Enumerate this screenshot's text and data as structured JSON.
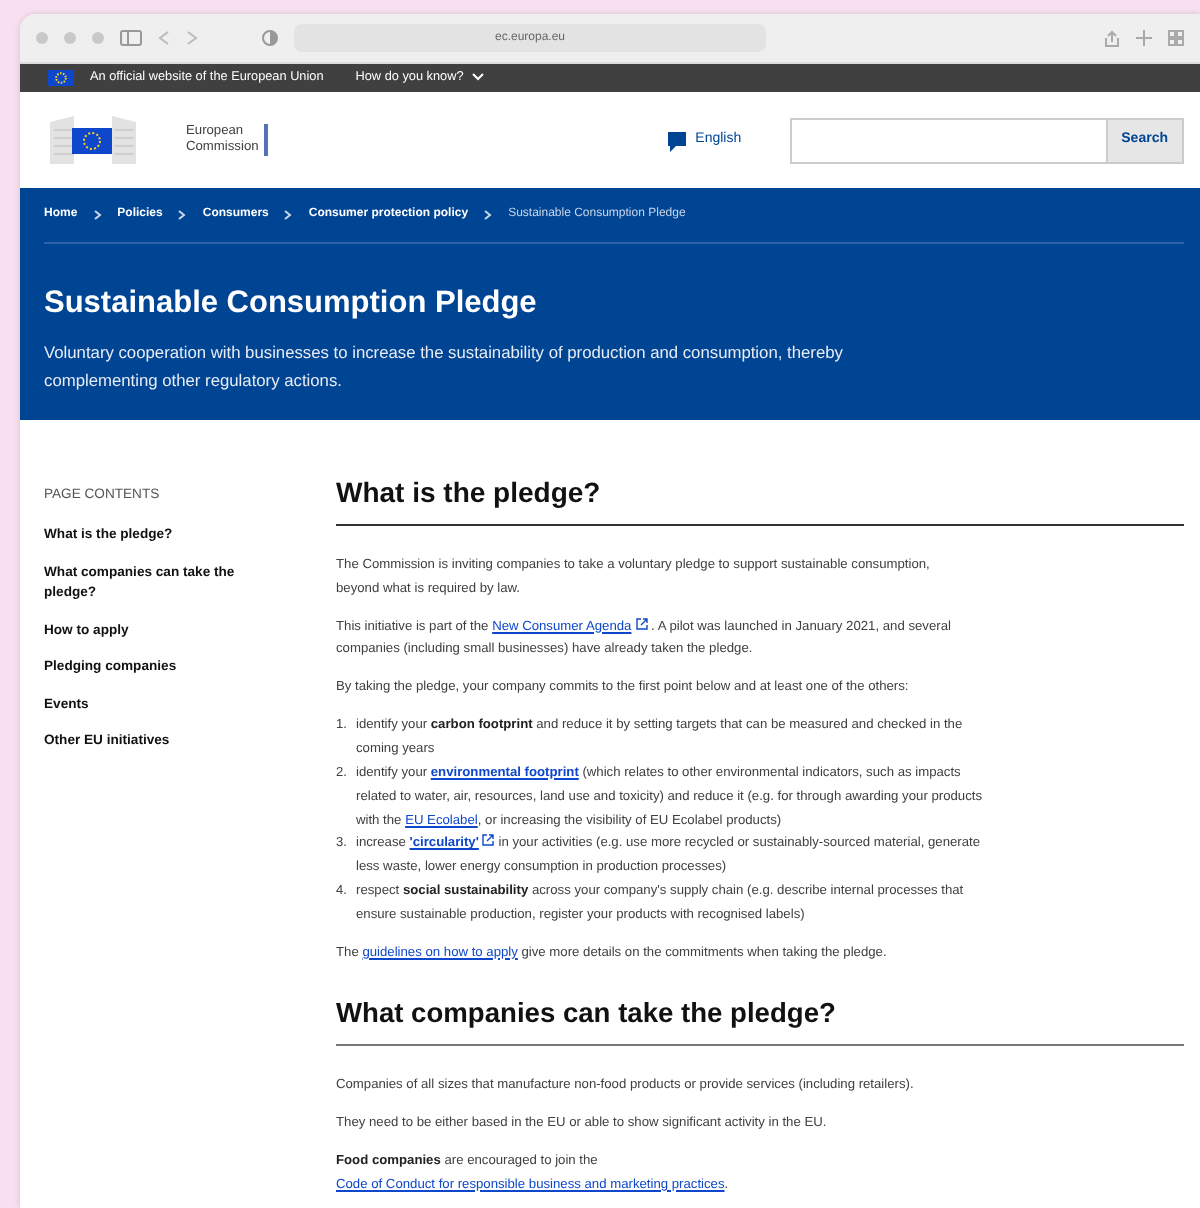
{
  "browser": {
    "url": "ec.europa.eu"
  },
  "eu_bar": {
    "text": "An official website of the European Union",
    "link": "How do you know?"
  },
  "header": {
    "logo_lines": [
      "European",
      "Commission"
    ],
    "language": "English",
    "search_button": "Search"
  },
  "breadcrumb": [
    {
      "label": "Home",
      "current": false
    },
    {
      "label": "Policies",
      "current": false
    },
    {
      "label": "Consumers",
      "current": false
    },
    {
      "label": "Consumer protection policy",
      "current": false
    },
    {
      "label": "Sustainable Consumption Pledge",
      "current": true
    }
  ],
  "hero": {
    "title": "Sustainable Consumption Pledge",
    "subtitle": "Voluntary cooperation with businesses to increase the sustainability of production and consumption, thereby complementing other regulatory actions."
  },
  "page_contents": {
    "heading": "PAGE CONTENTS",
    "items": [
      "What is the pledge?",
      "What companies can take the pledge?",
      "How to apply",
      "Pledging companies",
      "Events",
      "Other EU initiatives"
    ]
  },
  "sections": [
    {
      "heading": "What is the pledge?",
      "blocks": [
        {
          "kind": "paragraph",
          "parts": [
            {
              "kind": "plain",
              "text": "The Commission is inviting companies to take a voluntary pledge to support sustainable consumption, beyond what is required by law."
            }
          ]
        },
        {
          "kind": "paragraph",
          "parts": [
            {
              "kind": "plain",
              "text": "This initiative is part of the "
            },
            {
              "kind": "link",
              "text": "New Consumer Agenda",
              "external": true
            },
            {
              "kind": "plain",
              "text": " . A pilot was launched in January 2021, and several companies (including small businesses) have already taken the pledge."
            }
          ]
        },
        {
          "kind": "paragraph",
          "parts": [
            {
              "kind": "plain",
              "text": "By taking the pledge, your company commits to the first point below and at least one of the others:"
            }
          ]
        },
        {
          "kind": "list",
          "items": [
            {
              "number": "1.",
              "parts": [
                {
                  "kind": "plain",
                  "text": "identify your "
                },
                {
                  "kind": "bold",
                  "text": "carbon footprint"
                },
                {
                  "kind": "plain",
                  "text": " and reduce it by setting targets that can be measured and checked in the coming years"
                }
              ]
            },
            {
              "number": "2.",
              "parts": [
                {
                  "kind": "plain",
                  "text": "identify your "
                },
                {
                  "kind": "bold_link",
                  "text": "environmental footprint"
                },
                {
                  "kind": "plain",
                  "text": " (which relates to other environmental indicators, such as impacts related to water, air, resources, land use and toxicity) and reduce it (e.g. for  through awarding your products with the "
                },
                {
                  "kind": "link",
                  "text": "EU Ecolabel"
                },
                {
                  "kind": "plain",
                  "text": ", or increasing the visibility of EU Ecolabel products)"
                }
              ]
            },
            {
              "number": "3.",
              "parts": [
                {
                  "kind": "plain",
                  "text": "increase "
                },
                {
                  "kind": "bold_link",
                  "text": "'circularity'",
                  "external": true
                },
                {
                  "kind": "plain",
                  "text": "  in your activities  (e.g. use more recycled or sustainably-sourced material, generate less waste, lower energy consumption in production processes)"
                }
              ]
            },
            {
              "number": "4.",
              "parts": [
                {
                  "kind": "plain",
                  "text": "respect "
                },
                {
                  "kind": "bold",
                  "text": "social sustainability"
                },
                {
                  "kind": "plain",
                  "text": " across your company's supply chain (e.g. describe internal processes that ensure sustainable production, register your products with recognised labels)"
                }
              ]
            }
          ]
        },
        {
          "kind": "paragraph",
          "parts": [
            {
              "kind": "plain",
              "text": "The "
            },
            {
              "kind": "link",
              "text": "guidelines on how to apply"
            },
            {
              "kind": "plain",
              "text": " give more details on the commitments when taking the pledge."
            }
          ]
        }
      ]
    },
    {
      "heading": "What companies can take the pledge?",
      "blocks": [
        {
          "kind": "paragraph",
          "parts": [
            {
              "kind": "plain",
              "text": "Companies of all sizes that manufacture non-food products or provide services (including retailers)."
            }
          ]
        },
        {
          "kind": "paragraph",
          "parts": [
            {
              "kind": "plain",
              "text": "They need to be either based in the EU or able to show significant activity in the EU."
            }
          ]
        },
        {
          "kind": "paragraph",
          "parts": [
            {
              "kind": "bold",
              "text": "Food companies"
            },
            {
              "kind": "plain",
              "text": " are encouraged to join the "
            },
            {
              "kind": "link",
              "text": "Code of Conduct for responsible business and marketing practices"
            },
            {
              "kind": "plain",
              "text": "."
            }
          ]
        }
      ]
    }
  ]
}
